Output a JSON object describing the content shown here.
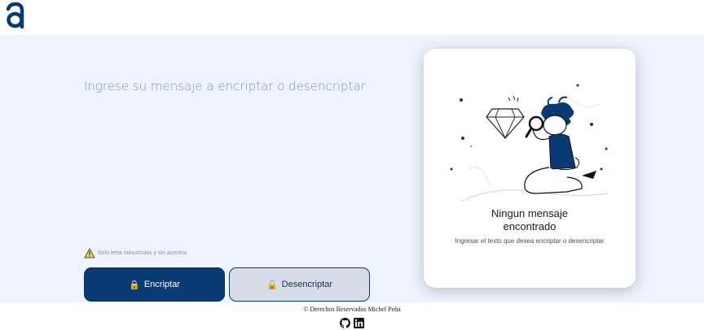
{
  "app": {
    "logo_letter": "a",
    "brand_color": "#0a3a74"
  },
  "editor": {
    "placeholder": "Ingrese su mensaje a encriptar o desencriptar",
    "hint": "Solo letra minusculas y sin acentos"
  },
  "buttons": {
    "encrypt_label": "Encriptar",
    "decrypt_label": "Desencriptar",
    "encrypt_icon": "lock-icon",
    "decrypt_icon": "unlock-icon"
  },
  "result": {
    "title_line1": "Ningun mensaje",
    "title_line2": "encontrado",
    "subtitle": "Ingresar el texto que desea encriptar o desencriptar",
    "illustration": "person-with-magnifier-illustration"
  },
  "footer": {
    "copyright": "© Derechos Reservados Michel Peña",
    "social_icons": [
      "github-icon",
      "linkedin-icon"
    ]
  }
}
